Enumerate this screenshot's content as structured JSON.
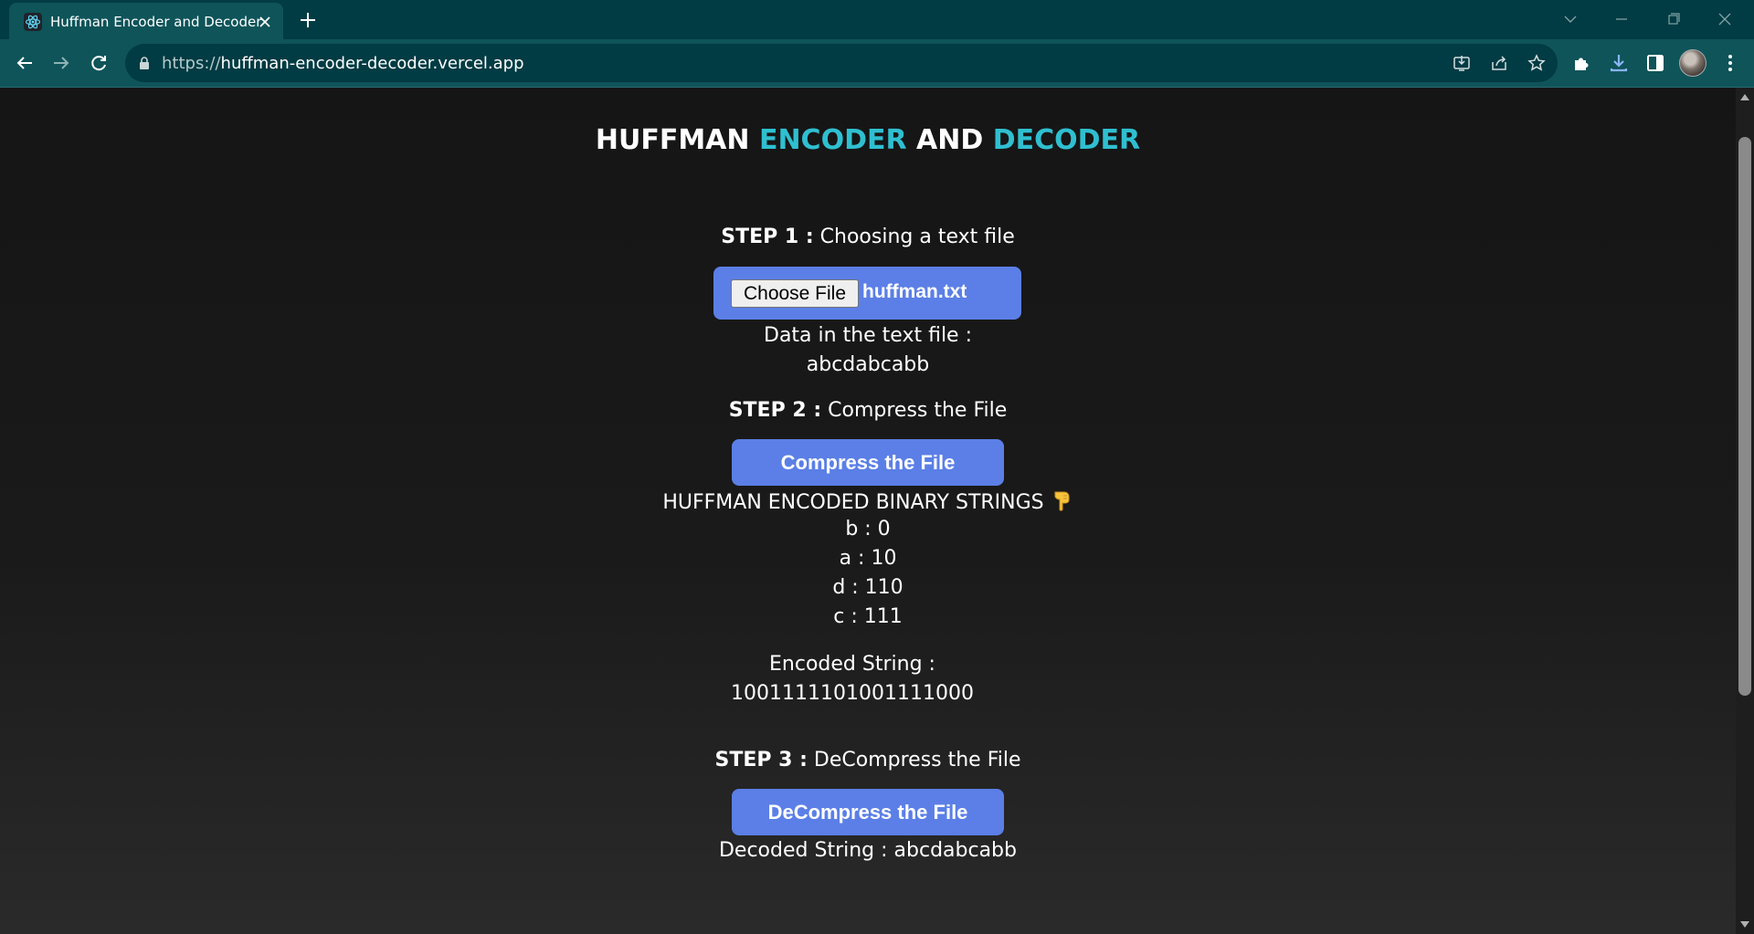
{
  "browser": {
    "tab_title": "Huffman Encoder and Decoder",
    "url_scheme": "https://",
    "url_host": "huffman-encoder-decoder.vercel.app"
  },
  "page": {
    "title_parts": [
      "HUFFMAN ",
      "ENCODER",
      " AND ",
      "DECODER"
    ],
    "accent_color": "#2fbfd0",
    "button_color": "#5b7fe6",
    "step1": {
      "label": "STEP 1 :",
      "text": " Choosing a text file"
    },
    "file_input": {
      "button_label": "Choose File",
      "file_name": "huffman.txt"
    },
    "data_label": "Data in the text file :",
    "data_value": "abcdabcabb",
    "step2": {
      "label": "STEP 2 :",
      "text": " Compress the File"
    },
    "compress_button": "Compress the File",
    "codes_heading": "HUFFMAN ENCODED BINARY STRINGS",
    "codes_heading_icon": "pointing-down-hand-icon",
    "codes": [
      "b : 0",
      "a : 10",
      "d : 110",
      "c : 111"
    ],
    "encoded_label": "Encoded String :",
    "encoded_value": "1001111101001111000",
    "step3": {
      "label": "STEP 3 :",
      "text": " DeCompress the File"
    },
    "decompress_button": "DeCompress the File",
    "decoded_line": "Decoded String : abcdabcabb"
  }
}
